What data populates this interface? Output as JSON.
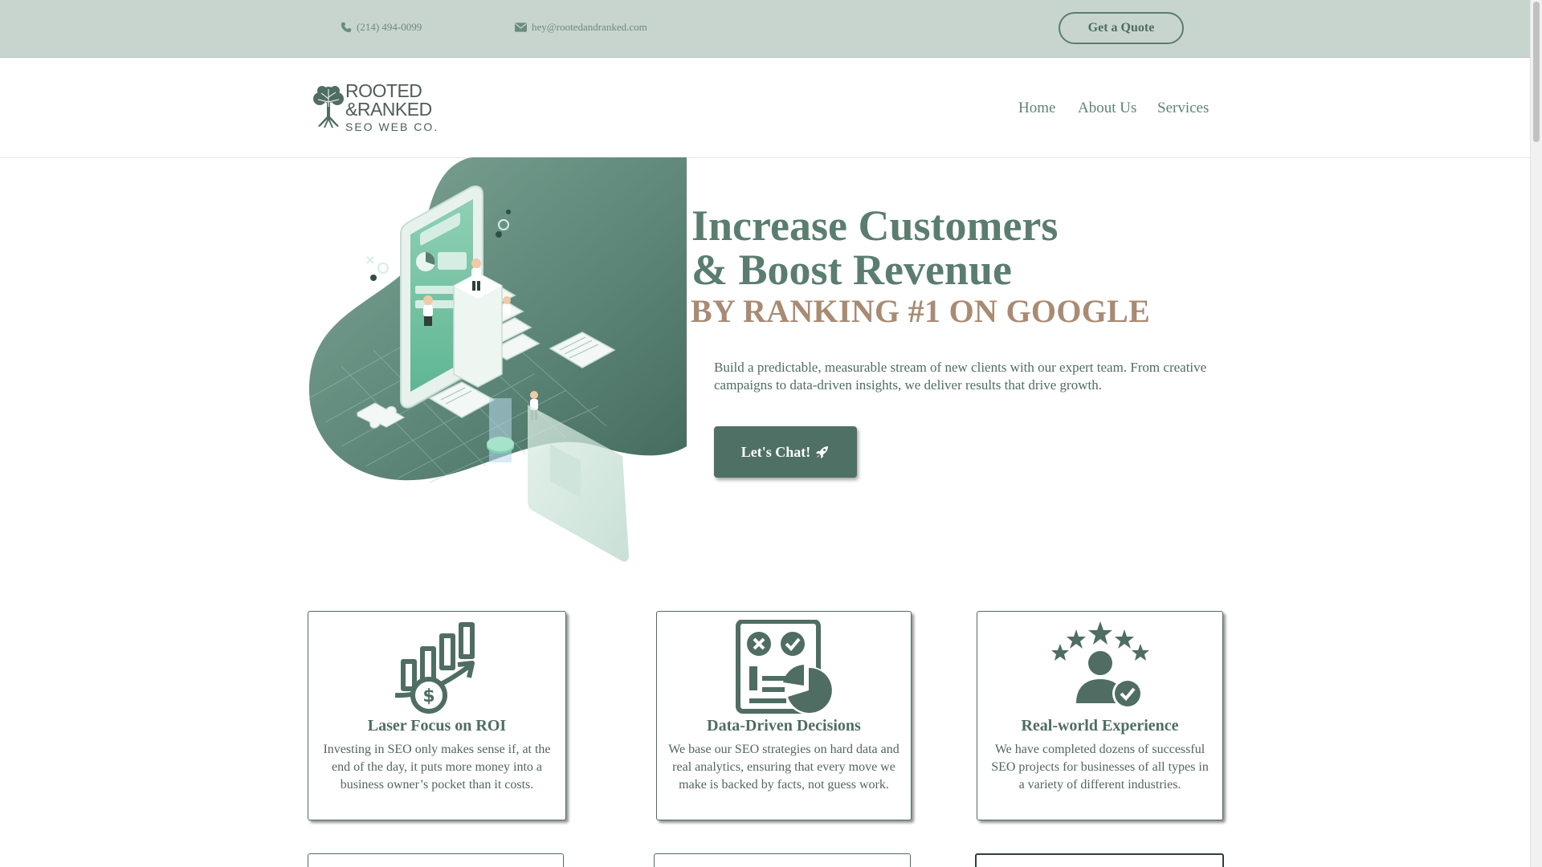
{
  "topbar": {
    "phone": "(214) 494-0099",
    "email": "hey@rootedandranked.com",
    "quote_button": "Get a Quote"
  },
  "header": {
    "logo": {
      "line1": "ROOTED",
      "line2": "&RANKED",
      "line3": "SEO WEB CO."
    },
    "nav": [
      "Home",
      "About Us",
      "Services"
    ]
  },
  "hero": {
    "title_line1": "Increase Customers",
    "title_line2": "& Boost Revenue",
    "subtitle": "BY RANKING #1 ON GOOGLE",
    "description": "Build a predictable, measurable stream of new clients with our expert team. From creative campaigns to data-driven insights, we deliver results that drive growth.",
    "cta": "Let's Chat!"
  },
  "features": [
    {
      "icon": "roi-chart-icon",
      "title": "Laser Focus on ROI",
      "text": "Investing in SEO only makes sense if, at the end of the day, it puts more money into a business owner’s pocket than it costs."
    },
    {
      "icon": "data-report-icon",
      "title": "Data-Driven Decisions",
      "text": "We base our SEO strategies on hard data and real analytics, ensuring that every move we make is backed by facts, not guess work."
    },
    {
      "icon": "expert-stars-icon",
      "title": "Real-world Experience",
      "text": "We have completed dozens of successful SEO projects for businesses of all types in a variety of different industries."
    }
  ],
  "colors": {
    "brand_green": "#5a7d70",
    "dark_green": "#4f7064",
    "topbar_bg": "#c8d5cf",
    "accent_tan": "#a98a73"
  }
}
